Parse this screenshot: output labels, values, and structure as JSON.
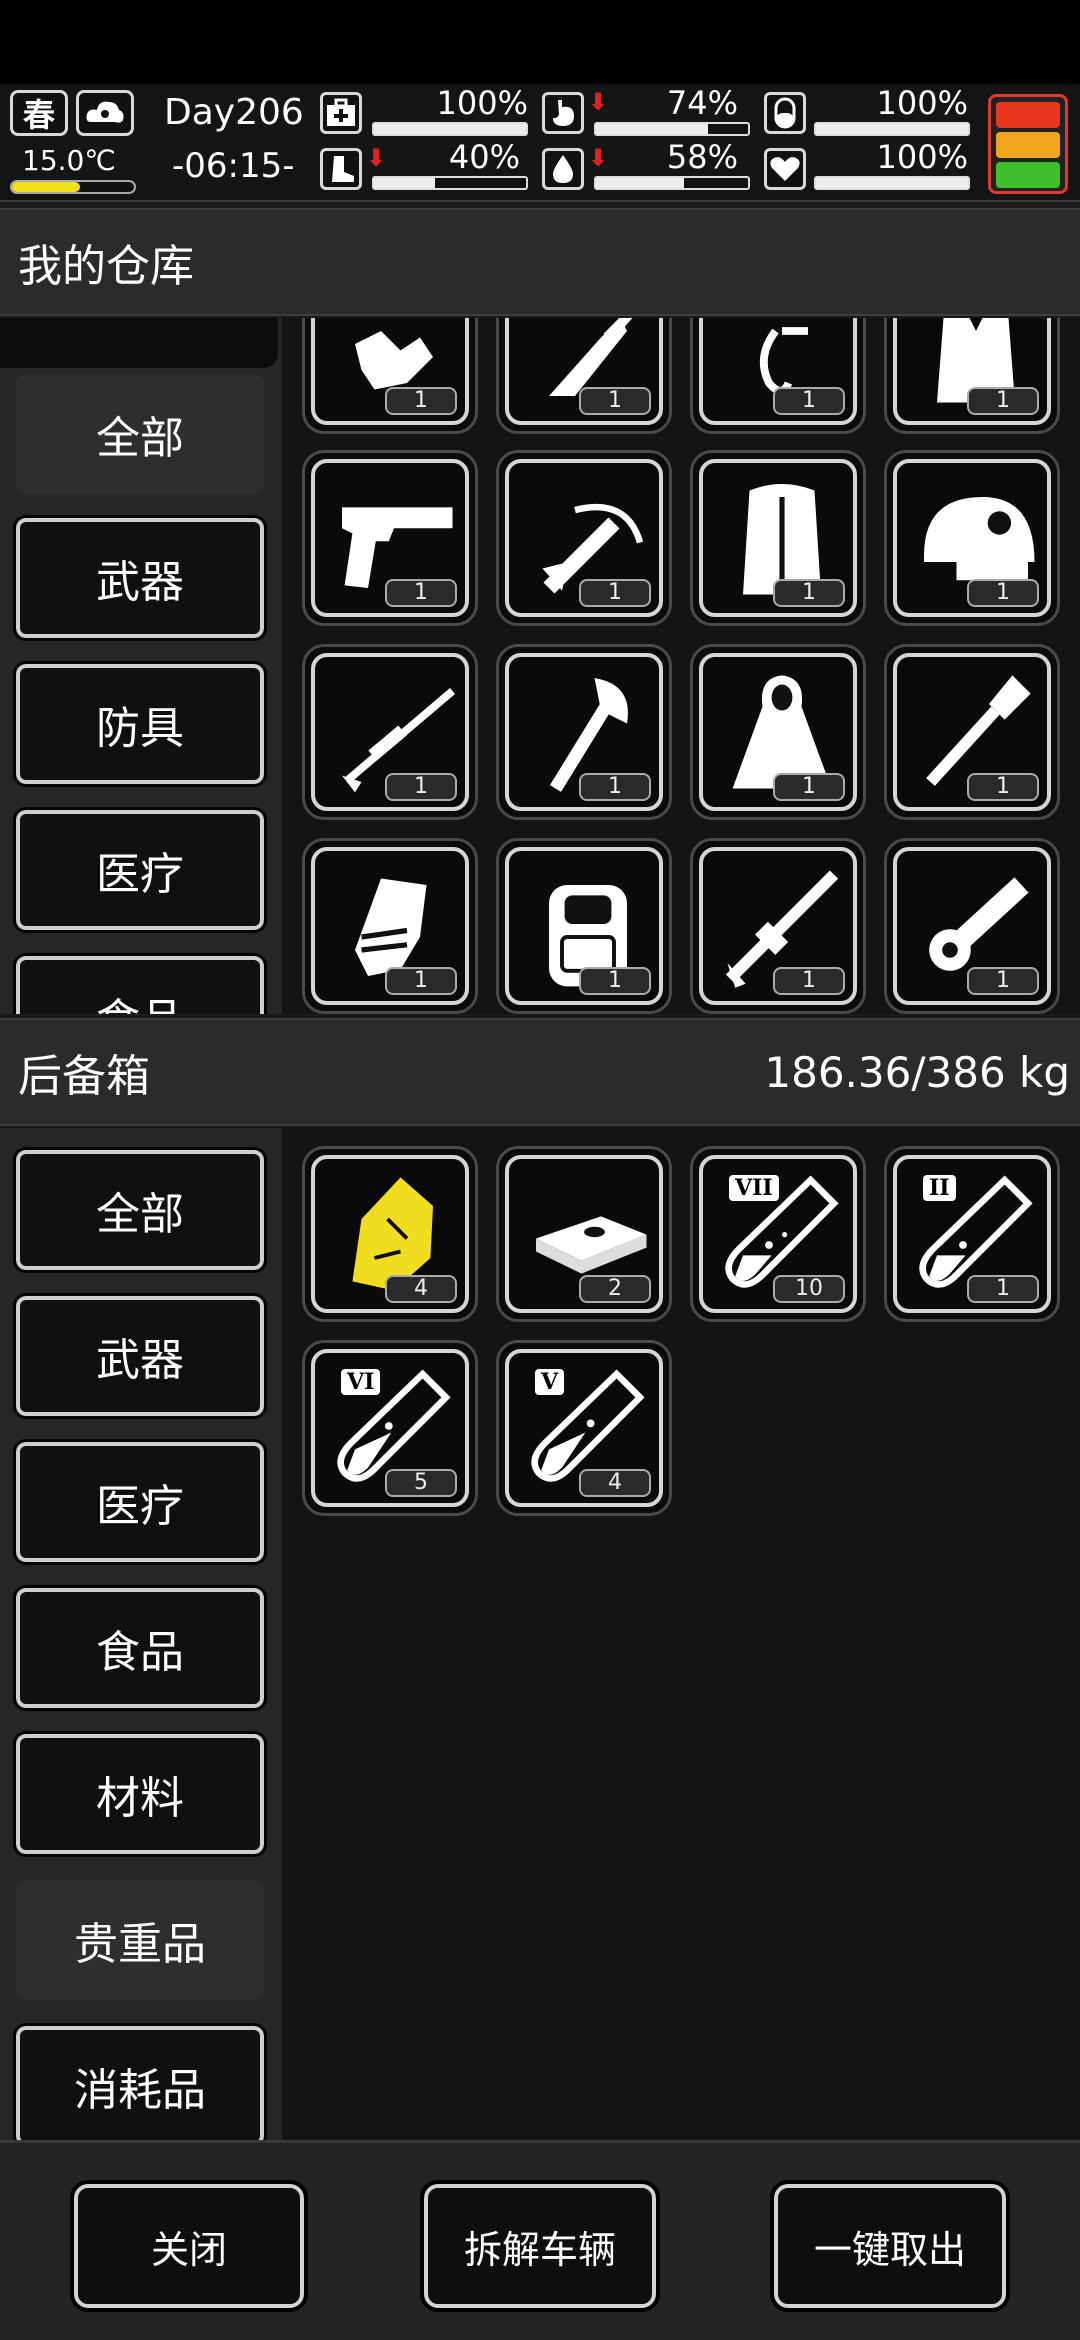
{
  "status": {
    "season": "春",
    "temperature": "15.0℃",
    "day": "Day206",
    "time": "-06:15-",
    "stats": [
      {
        "name": "health",
        "icon": "medkit-icon",
        "value": "100%",
        "level": 1.0,
        "arrow": false
      },
      {
        "name": "hunger",
        "icon": "stomach-icon",
        "value": "74%",
        "level": 0.74,
        "arrow": true
      },
      {
        "name": "pill",
        "icon": "pill-icon",
        "value": "100%",
        "level": 1.0,
        "arrow": false
      },
      {
        "name": "stamina",
        "icon": "boot-icon",
        "value": "40%",
        "level": 0.4,
        "arrow": true
      },
      {
        "name": "thirst",
        "icon": "water-drop-icon",
        "value": "58%",
        "level": 0.58,
        "arrow": true
      },
      {
        "name": "mood",
        "icon": "heart-icon",
        "value": "100%",
        "level": 1.0,
        "arrow": false
      }
    ],
    "alert_colors": [
      "#e8361f",
      "#f0a51e",
      "#3fbf2a"
    ]
  },
  "warehouse": {
    "title": "我的仓库",
    "categories": [
      "全部",
      "武器",
      "防具",
      "医疗",
      "食品"
    ],
    "active_index": 0,
    "items": [
      {
        "icon": "gloves-icon",
        "count": "1"
      },
      {
        "icon": "machete-icon",
        "count": "1"
      },
      {
        "icon": "tool-icon",
        "count": "1"
      },
      {
        "icon": "coat-icon",
        "count": "1"
      },
      {
        "icon": "pistol-icon",
        "count": "1"
      },
      {
        "icon": "crossbow-icon",
        "count": "1"
      },
      {
        "icon": "fur-vest-icon",
        "count": "1"
      },
      {
        "icon": "helmet-icon",
        "count": "1"
      },
      {
        "icon": "sniper-rifle-icon",
        "count": "1"
      },
      {
        "icon": "axe-icon",
        "count": "1"
      },
      {
        "icon": "cloak-icon",
        "count": "1"
      },
      {
        "icon": "shovel-icon",
        "count": "1"
      },
      {
        "icon": "gauntlet-icon",
        "count": "1"
      },
      {
        "icon": "backpack-icon",
        "count": "1"
      },
      {
        "icon": "assault-rifle-icon",
        "count": "1"
      },
      {
        "icon": "minigun-icon",
        "count": "1"
      }
    ]
  },
  "trunk": {
    "title": "后备箱",
    "weight": "186.36/386 kg",
    "categories": [
      "全部",
      "武器",
      "医疗",
      "食品",
      "材料",
      "贵重品",
      "消耗品"
    ],
    "active_index": 5,
    "items": [
      {
        "icon": "gold-nugget-icon",
        "count": "4"
      },
      {
        "icon": "cash-stack-icon",
        "count": "2"
      },
      {
        "icon": "test-tube-icon",
        "label": "VII",
        "count": "10"
      },
      {
        "icon": "test-tube-icon",
        "label": "II",
        "count": "1"
      },
      {
        "icon": "test-tube-icon",
        "label": "VI",
        "count": "5"
      },
      {
        "icon": "test-tube-icon",
        "label": "V",
        "count": "4"
      }
    ]
  },
  "footer": {
    "close": "关闭",
    "dismantle": "拆解车辆",
    "take_all": "一键取出"
  }
}
